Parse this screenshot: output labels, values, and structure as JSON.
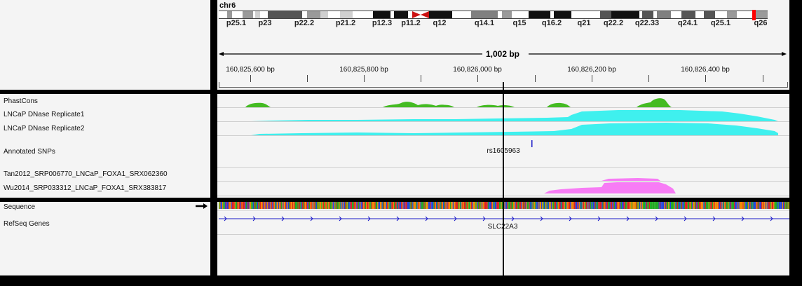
{
  "chromosome": {
    "name": "chr6",
    "band_labels": [
      "p25.1",
      "p23",
      "p22.2",
      "p21.2",
      "p12.3",
      "p11.2",
      "q12",
      "q14.1",
      "q15",
      "q16.2",
      "q21",
      "q22.2",
      "q22.33",
      "q24.1",
      "q25.1",
      "q26"
    ]
  },
  "ruler": {
    "span_label": "1,002 bp",
    "tick_labels": [
      "160,825,600 bp",
      "160,825,800 bp",
      "160,826,000 bp",
      "160,826,200 bp",
      "160,826,400 bp"
    ]
  },
  "tracks": {
    "phastcons": "PhastCons",
    "dnase1": "LNCaP DNase Replicate1",
    "dnase2": "LNCaP DNase Replicate2",
    "snps": "Annotated SNPs",
    "tan": "Tan2012_SRP006770_LNCaP_FOXA1_SRX062360",
    "wu": "Wu2014_SRP033312_LNCaP_FOXA1_SRX383817",
    "sequence": "Sequence",
    "refseq": "RefSeq Genes"
  },
  "features": {
    "snp_id": "rs1605963",
    "gene": "SLC22A3"
  },
  "colors": {
    "phastcons": "#44bb22",
    "dnase": "#3ff0ee",
    "foxa1": "#f77cf5",
    "gene": "#1a1ac8",
    "centromere": "#cc1111"
  }
}
